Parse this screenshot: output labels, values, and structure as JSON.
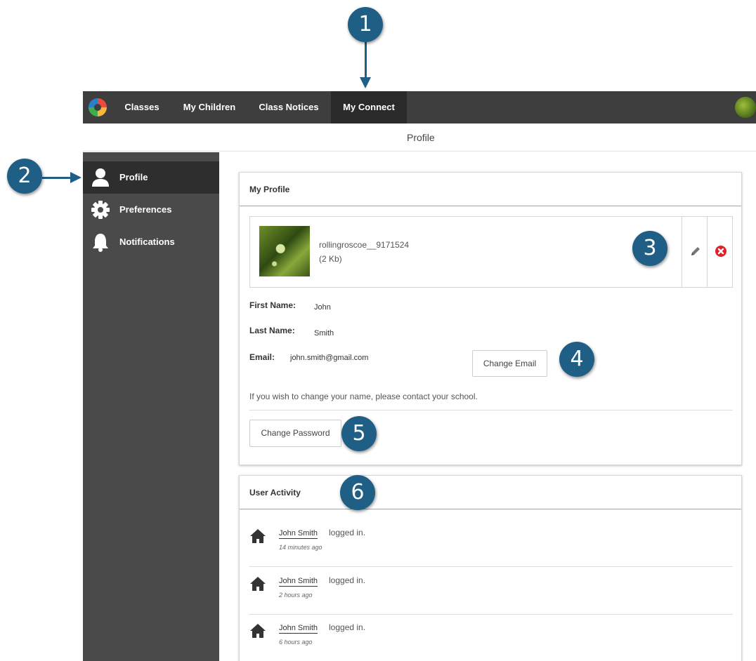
{
  "callouts": [
    "1",
    "2",
    "3",
    "4",
    "5",
    "6"
  ],
  "nav": {
    "items": [
      {
        "label": "Classes"
      },
      {
        "label": "My Children"
      },
      {
        "label": "Class Notices"
      },
      {
        "label": "My Connect"
      }
    ],
    "active_index": 3
  },
  "page_title": "Profile",
  "sidebar": {
    "items": [
      {
        "label": "Profile",
        "icon": "user-icon"
      },
      {
        "label": "Preferences",
        "icon": "gear-icon"
      },
      {
        "label": "Notifications",
        "icon": "bell-icon"
      }
    ],
    "active_index": 0
  },
  "profile": {
    "title": "My Profile",
    "file": {
      "name": "rollingroscoe__9171524",
      "size": "(2 Kb)"
    },
    "first_name_label": "First Name:",
    "first_name": "John",
    "last_name_label": "Last Name:",
    "last_name": "Smith",
    "email_label": "Email:",
    "email": "john.smith@gmail.com",
    "change_email_label": "Change Email",
    "note": "If you wish to change your name, please contact your school.",
    "change_password_label": "Change Password"
  },
  "activity": {
    "title": "User Activity",
    "items": [
      {
        "user": "John Smith",
        "action": "logged in.",
        "time": "14 minutes ago"
      },
      {
        "user": "John Smith",
        "action": "logged in.",
        "time": "2 hours ago"
      },
      {
        "user": "John Smith",
        "action": "logged in.",
        "time": "6 hours ago"
      }
    ]
  },
  "colors": {
    "callout": "#1f5f86",
    "topbar": "#3e3e3e",
    "sidebar": "#4a4a4a",
    "accent_line": "#8cc63f",
    "delete": "#e0202a"
  }
}
